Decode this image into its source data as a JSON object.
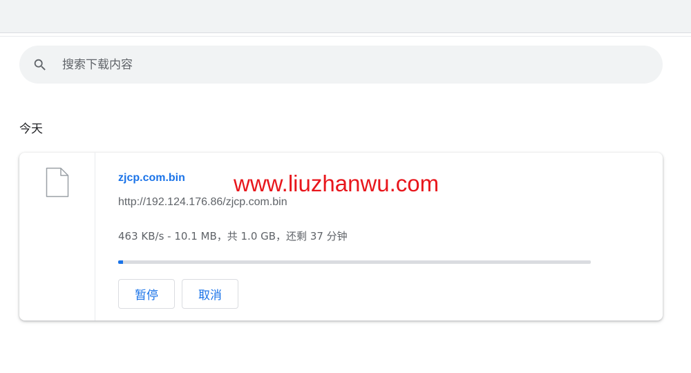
{
  "search": {
    "placeholder": "搜索下载内容",
    "icon": "search-icon"
  },
  "section": {
    "title": "今天"
  },
  "downloads": [
    {
      "icon": "file-icon",
      "file_name": "zjcp.com.bin",
      "url": "http://192.124.176.86/zjcp.com.bin",
      "status": "463 KB/s - 10.1 MB，共 1.0 GB，还剩 37 分钟",
      "progress_percent": 1,
      "pause_label": "暂停",
      "cancel_label": "取消"
    }
  ],
  "watermark": {
    "text": "www.liuzhanwu.com"
  },
  "colors": {
    "accent": "#1a73e8",
    "watermark": "#e8161c",
    "toolbar_bg": "#f1f3f4"
  }
}
